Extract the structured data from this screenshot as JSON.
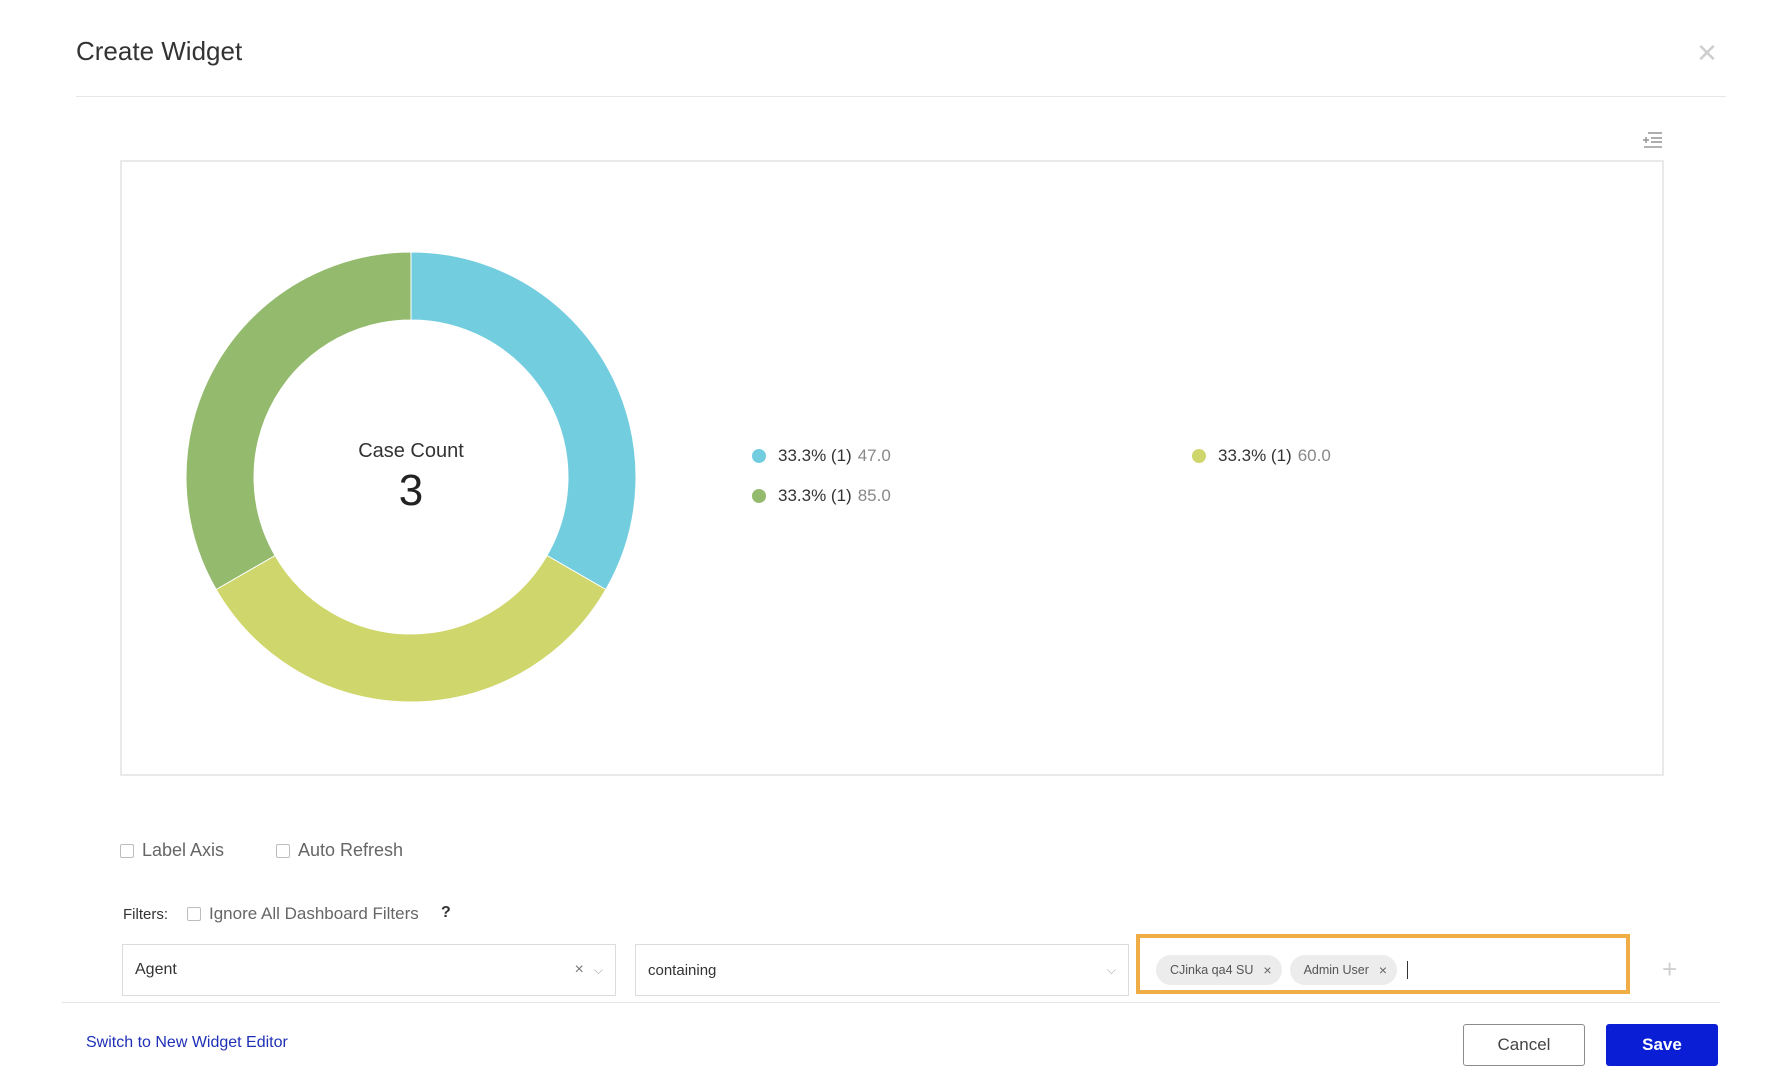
{
  "dialog": {
    "title": "Create Widget"
  },
  "chart_data": {
    "type": "pie",
    "center_label": "Case Count",
    "center_value": "3",
    "slices": [
      {
        "label": "47.0",
        "percent_label": "33.3% (1)",
        "percent": 33.3,
        "count": 1,
        "color": "#72cddf"
      },
      {
        "label": "60.0",
        "percent_label": "33.3% (1)",
        "percent": 33.3,
        "count": 1,
        "color": "#cfd66c"
      },
      {
        "label": "85.0",
        "percent_label": "33.3% (1)",
        "percent": 33.3,
        "count": 1,
        "color": "#93ba6d"
      }
    ]
  },
  "options": {
    "label_axis": "Label Axis",
    "auto_refresh": "Auto Refresh"
  },
  "filters": {
    "label": "Filters:",
    "ignore_all": "Ignore All Dashboard Filters",
    "help": "?",
    "field_value": "Agent",
    "operator_value": "containing",
    "tags": [
      "CJinka qa4 SU",
      "Admin User"
    ]
  },
  "footer": {
    "switch_link": "Switch to New Widget Editor",
    "cancel_label": "Cancel",
    "save_label": "Save"
  },
  "colors": {
    "accent": "#0a1ed6",
    "highlight": "#f0ac45",
    "link": "#1f2fb6"
  }
}
